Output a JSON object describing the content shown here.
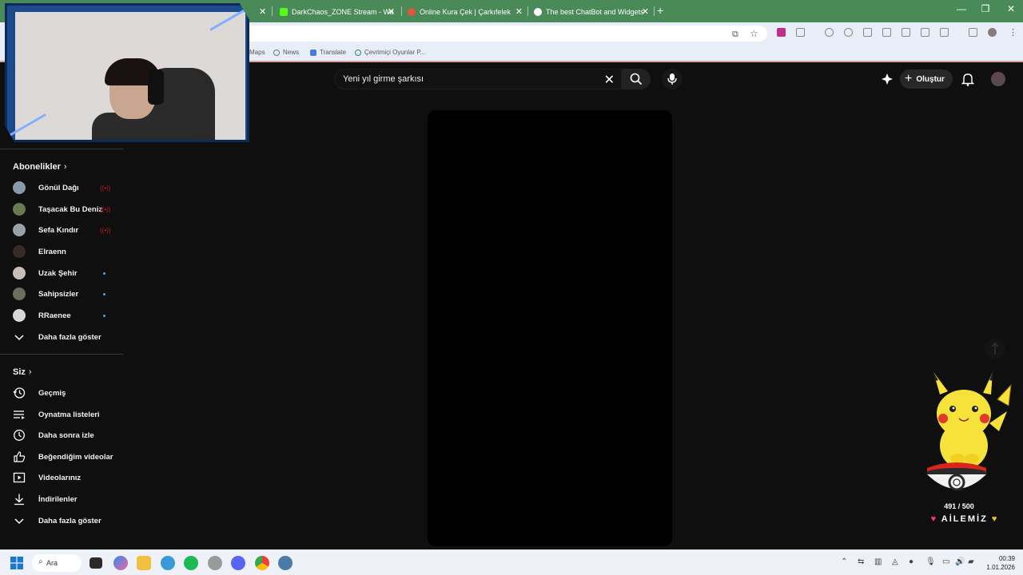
{
  "browser": {
    "tabs": [
      {
        "title": "DarkChaos_ZONE Stream - Wa",
        "icon": "kick-icon",
        "color": "#53fc18"
      },
      {
        "title": "Online Kura Çek | Çarkıfelek",
        "icon": "wheel-icon",
        "color": "#e0563a"
      },
      {
        "title": "The best ChatBot and Widgets",
        "icon": "chatbot-icon",
        "color": "#ffffff"
      }
    ],
    "bookmarks": [
      {
        "label": "Maps"
      },
      {
        "label": "News"
      },
      {
        "label": "Translate"
      },
      {
        "label": "Çevrimiçi Oyunlar P..."
      }
    ]
  },
  "header": {
    "search_query": "Yeni yıl girme şarkısı",
    "create_label": "Oluştur"
  },
  "sidebar": {
    "subscriptions_title": "Abonelikler",
    "subscriptions": [
      {
        "name": "Gönül Dağı",
        "status": "live",
        "avatar_color": "#8a9aa8"
      },
      {
        "name": "Taşacak Bu Deniz",
        "status": "live",
        "avatar_color": "#6a7a50"
      },
      {
        "name": "Sefa Kındır",
        "status": "live",
        "avatar_color": "#9aa0a8"
      },
      {
        "name": "Elraenn",
        "status": "none",
        "avatar_color": "#3a2a24"
      },
      {
        "name": "Uzak Şehir",
        "status": "new",
        "avatar_color": "#c8c0b8"
      },
      {
        "name": "Sahipsizler",
        "status": "new",
        "avatar_color": "#6b6f5a"
      },
      {
        "name": "RRaenee",
        "status": "new",
        "avatar_color": "#d8d8d8"
      }
    ],
    "subs_show_more": "Daha fazla göster",
    "you_title": "Siz",
    "you_items": [
      {
        "label": "Geçmiş",
        "icon": "history-icon"
      },
      {
        "label": "Oynatma listeleri",
        "icon": "playlists-icon"
      },
      {
        "label": "Daha sonra izle",
        "icon": "watch-later-icon"
      },
      {
        "label": "Beğendiğim videolar",
        "icon": "liked-videos-icon"
      },
      {
        "label": "Videolarınız",
        "icon": "your-videos-icon"
      },
      {
        "label": "İndirilenler",
        "icon": "downloads-icon"
      }
    ],
    "you_show_more": "Daha fazla göster"
  },
  "overlay": {
    "count": "491 / 500",
    "family_label": "AİLEMİZ"
  },
  "taskbar": {
    "search_label": "Ara",
    "time": "00:39",
    "date": "1.01.2026"
  }
}
